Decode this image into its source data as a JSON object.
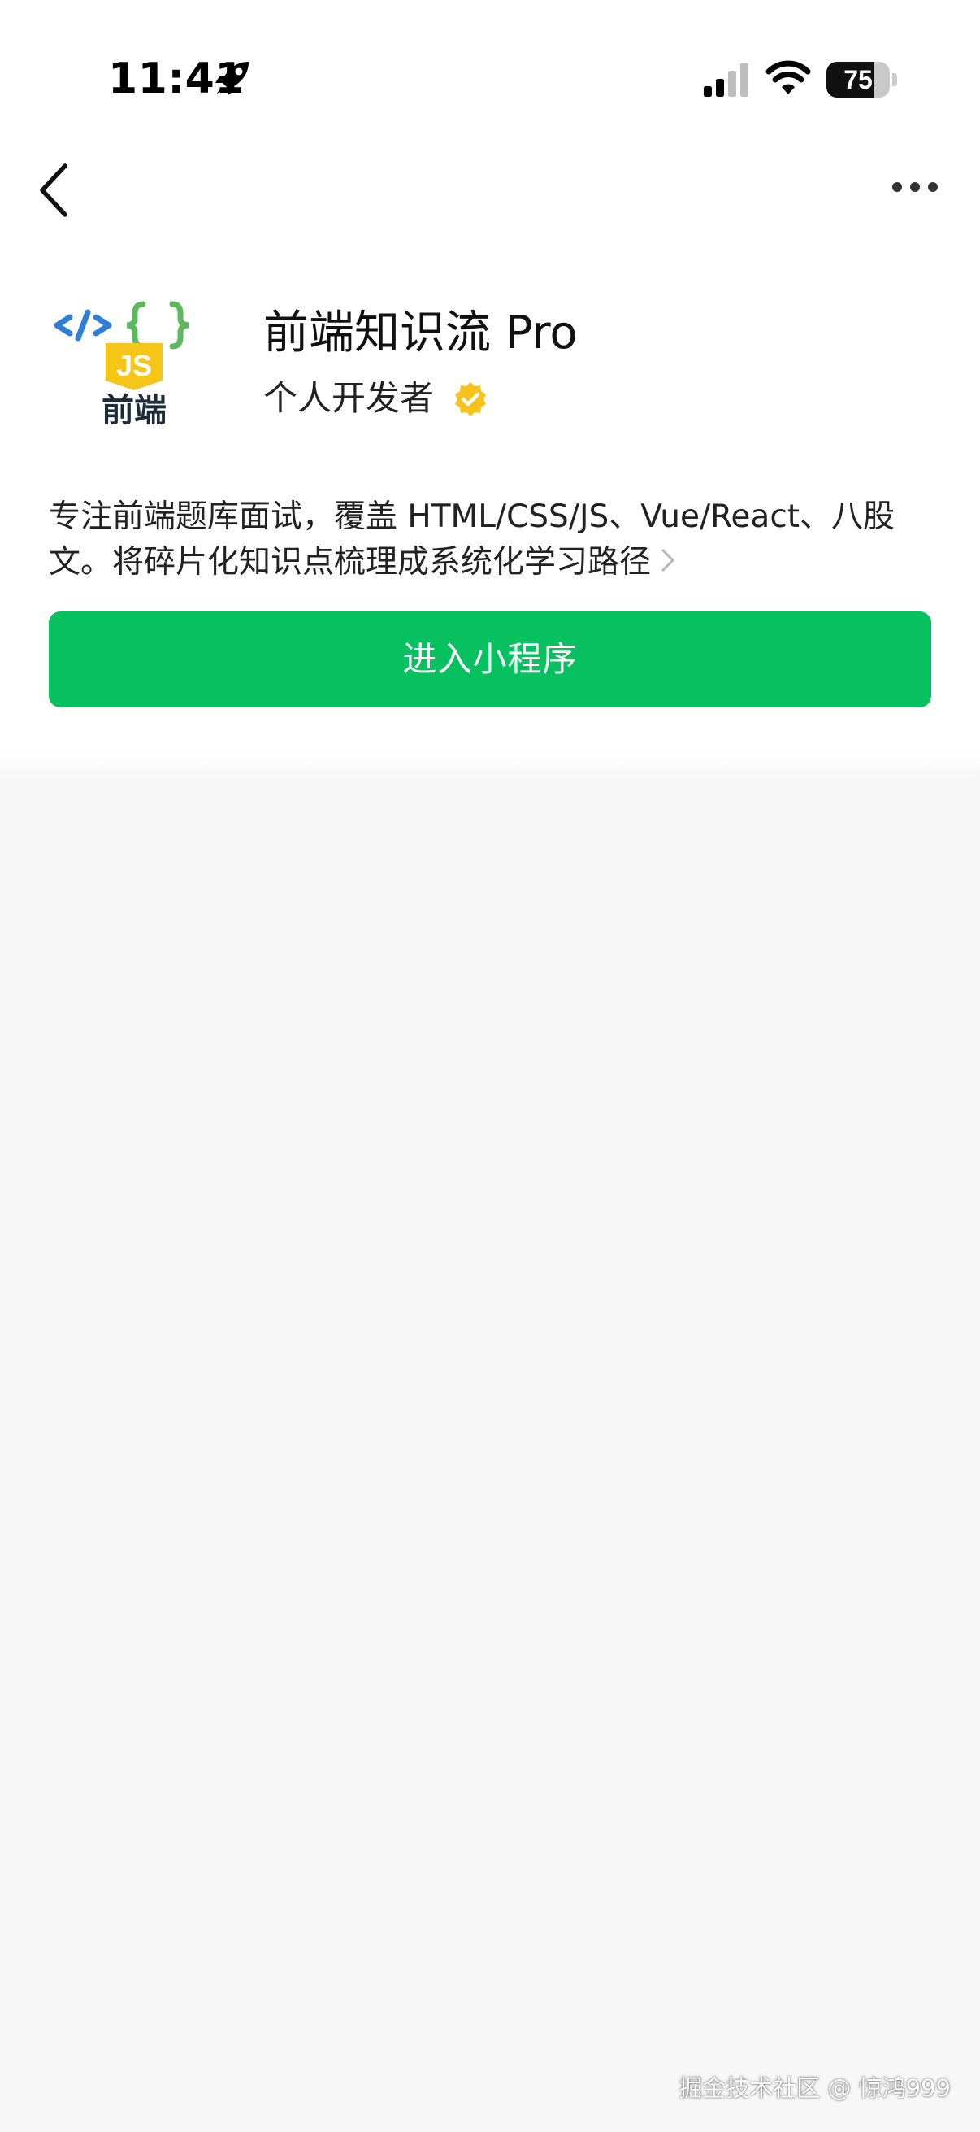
{
  "status_bar": {
    "time": "11:41",
    "time_icon": "rocket-icon",
    "signal_icon": "cellular-signal-icon",
    "wifi_icon": "wifi-icon",
    "battery_level": "75",
    "battery_fraction": 0.75
  },
  "nav": {
    "back_icon": "chevron-left-icon",
    "more_icon": "more-dots-icon"
  },
  "profile": {
    "logo_text": "前端",
    "logo_badge": "JS",
    "name": "前端知识流 Pro",
    "developer_type": "个人开发者",
    "verified_icon": "verified-badge-icon",
    "description": "专注前端题库面试，覆盖 HTML/CSS/JS、Vue/React、八股文。将碎片化知识点梳理成系统化学习路径"
  },
  "actions": {
    "enter_label": "进入小程序"
  },
  "watermark": "掘金技术社区 @ 惊鸿999",
  "colors": {
    "accent_green": "#07c160",
    "verified_gold": "#f7c21b",
    "logo_blue": "#2f7fd6",
    "logo_green": "#5cb85c",
    "logo_yellow": "#f5c518"
  }
}
